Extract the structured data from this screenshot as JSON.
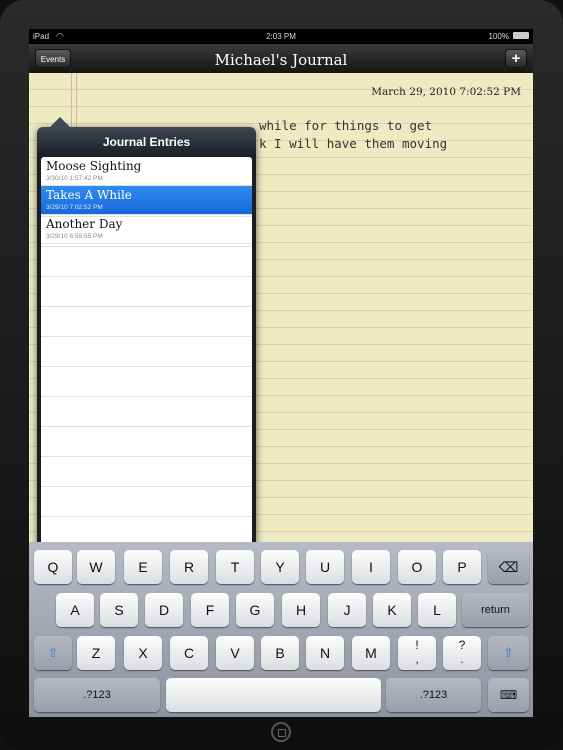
{
  "status": {
    "carrier": "iPad",
    "time": "2:03 PM",
    "battery": "100%"
  },
  "nav": {
    "title": "Michael's Journal",
    "events_label": "Events",
    "add_label": "+"
  },
  "entry": {
    "date": "March 29, 2010 7:02:52 PM",
    "text_line1": "while for things to get",
    "text_line2": "k I will have them moving"
  },
  "popover": {
    "title": "Journal Entries",
    "items": [
      {
        "title": "Moose Sighting",
        "date": "3/30/10 1:57:42 PM",
        "selected": false
      },
      {
        "title": "Takes A While",
        "date": "3/29/10 7:02:52 PM",
        "selected": true
      },
      {
        "title": "Another Day",
        "date": "3/29/10 6:59:55 PM",
        "selected": false
      }
    ]
  },
  "keyboard": {
    "row1": [
      "Q",
      "W",
      "E",
      "R",
      "T",
      "Y",
      "U",
      "I",
      "O",
      "P"
    ],
    "row2": [
      "A",
      "S",
      "D",
      "F",
      "G",
      "H",
      "J",
      "K",
      "L"
    ],
    "row3": [
      "Z",
      "X",
      "C",
      "V",
      "B",
      "N",
      "M"
    ],
    "exclaim_top": "!",
    "exclaim_bottom": ",",
    "question_top": "?",
    "question_bottom": ".",
    "return_label": "return",
    "numbers_label": ".?123",
    "shift_icon": "shift-icon",
    "backspace_icon": "backspace-icon",
    "hide_keyboard_icon": "keyboard-hide-icon"
  }
}
